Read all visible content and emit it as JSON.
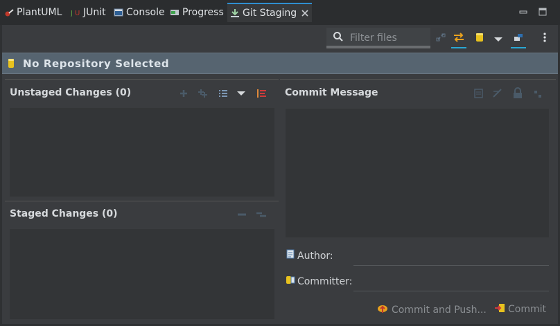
{
  "tabs": [
    {
      "label": "PlantUML",
      "icon": "plantuml-icon"
    },
    {
      "label": "JUnit",
      "icon": "junit-icon"
    },
    {
      "label": "Console",
      "icon": "console-icon"
    },
    {
      "label": "Progress",
      "icon": "progress-icon"
    },
    {
      "label": "Git Staging",
      "icon": "git-staging-icon",
      "active": true
    }
  ],
  "toolbar": {
    "filter_placeholder": "Filter files"
  },
  "banner": {
    "text": "No Repository Selected"
  },
  "unstaged": {
    "title": "Unstaged Changes (0)"
  },
  "staged": {
    "title": "Staged Changes (0)"
  },
  "commit": {
    "title": "Commit Message",
    "author_label": "Author:",
    "committer_label": "Committer:",
    "commit_and_push_label": "Commit and Push...",
    "commit_label": "Commit"
  },
  "colors": {
    "accent": "#2aa7d4",
    "banner_bg": "#566470",
    "repo_icon": "#e8c21e"
  }
}
